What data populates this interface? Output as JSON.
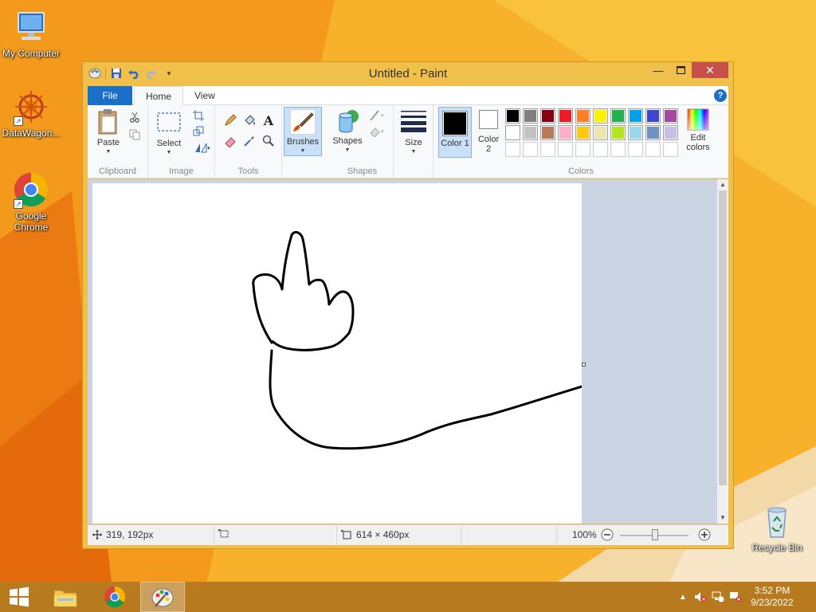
{
  "desktop": {
    "icons": [
      {
        "label": "My Computer"
      },
      {
        "label": "DataWagon..."
      },
      {
        "label": "Google Chrome"
      },
      {
        "label": "Recycle Bin"
      }
    ]
  },
  "window": {
    "title": "Untitled - Paint"
  },
  "tabs": {
    "file": "File",
    "home": "Home",
    "view": "View",
    "help": "?"
  },
  "ribbon": {
    "clipboard": {
      "label": "Clipboard",
      "paste": "Paste"
    },
    "image": {
      "label": "Image",
      "select": "Select"
    },
    "tools": {
      "label": "Tools"
    },
    "brushes": "Brushes",
    "shapes": {
      "label": "Shapes",
      "shapes_btn": "Shapes"
    },
    "size": "Size",
    "color1": "Color 1",
    "color2": "Color 2",
    "colors": {
      "label": "Colors",
      "edit": "Edit colors"
    },
    "palette_row1": [
      "#000000",
      "#7f7f7f",
      "#880015",
      "#ed1c24",
      "#ff7f27",
      "#fff200",
      "#22b14c",
      "#00a2e8",
      "#3f48cc",
      "#a349a4"
    ],
    "palette_row2": [
      "#ffffff",
      "#c3c3c3",
      "#b97a57",
      "#ffaec9",
      "#ffc90e",
      "#efe4b0",
      "#b5e61d",
      "#99d9ea",
      "#7092be",
      "#c8bfe7"
    ],
    "palette_row3": [
      "#ffffff",
      "#ffffff",
      "#ffffff",
      "#ffffff",
      "#ffffff",
      "#ffffff",
      "#ffffff",
      "#ffffff",
      "#ffffff",
      "#ffffff"
    ],
    "color1_value": "#000000",
    "color2_value": "#ffffff"
  },
  "status": {
    "cursor_pos": "319, 192px",
    "selection_size": "",
    "canvas_size": "614 × 460px",
    "zoom": "100%"
  },
  "taskbar": {
    "time": "3:52 PM",
    "date": "9/23/2022"
  }
}
